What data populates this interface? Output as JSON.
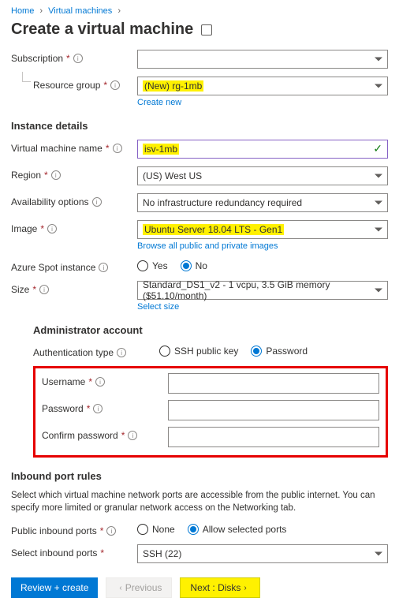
{
  "breadcrumb": {
    "home": "Home",
    "vms": "Virtual machines"
  },
  "title": "Create a virtual machine",
  "labels": {
    "subscription": "Subscription",
    "resource_group": "Resource group",
    "vm_name": "Virtual machine name",
    "region": "Region",
    "availability": "Availability options",
    "image": "Image",
    "spot": "Azure Spot instance",
    "size": "Size",
    "auth_type": "Authentication type",
    "username": "Username",
    "password": "Password",
    "confirm_password": "Confirm password",
    "public_inbound": "Public inbound ports",
    "select_inbound": "Select inbound ports"
  },
  "values": {
    "subscription": "",
    "resource_group": "(New) rg-1mb",
    "create_new": "Create new",
    "vm_name": "isv-1mb",
    "region": "(US) West US",
    "availability": "No infrastructure redundancy required",
    "image": "Ubuntu Server 18.04 LTS - Gen1",
    "browse_images": "Browse all public and private images",
    "size": "Standard_DS1_v2 - 1 vcpu, 3.5 GiB memory ($51.10/month)",
    "select_size": "Select size",
    "inbound_ports": "SSH (22)"
  },
  "sections": {
    "instance": "Instance details",
    "admin": "Administrator account",
    "inbound": "Inbound port rules",
    "inbound_desc": "Select which virtual machine network ports are accessible from the public internet. You can specify more limited or granular network access on the Networking tab."
  },
  "radios": {
    "yes": "Yes",
    "no": "No",
    "ssh": "SSH public key",
    "password": "Password",
    "none": "None",
    "allow": "Allow selected ports"
  },
  "footer": {
    "review": "Review + create",
    "previous": "Previous",
    "next": "Next : Disks"
  }
}
